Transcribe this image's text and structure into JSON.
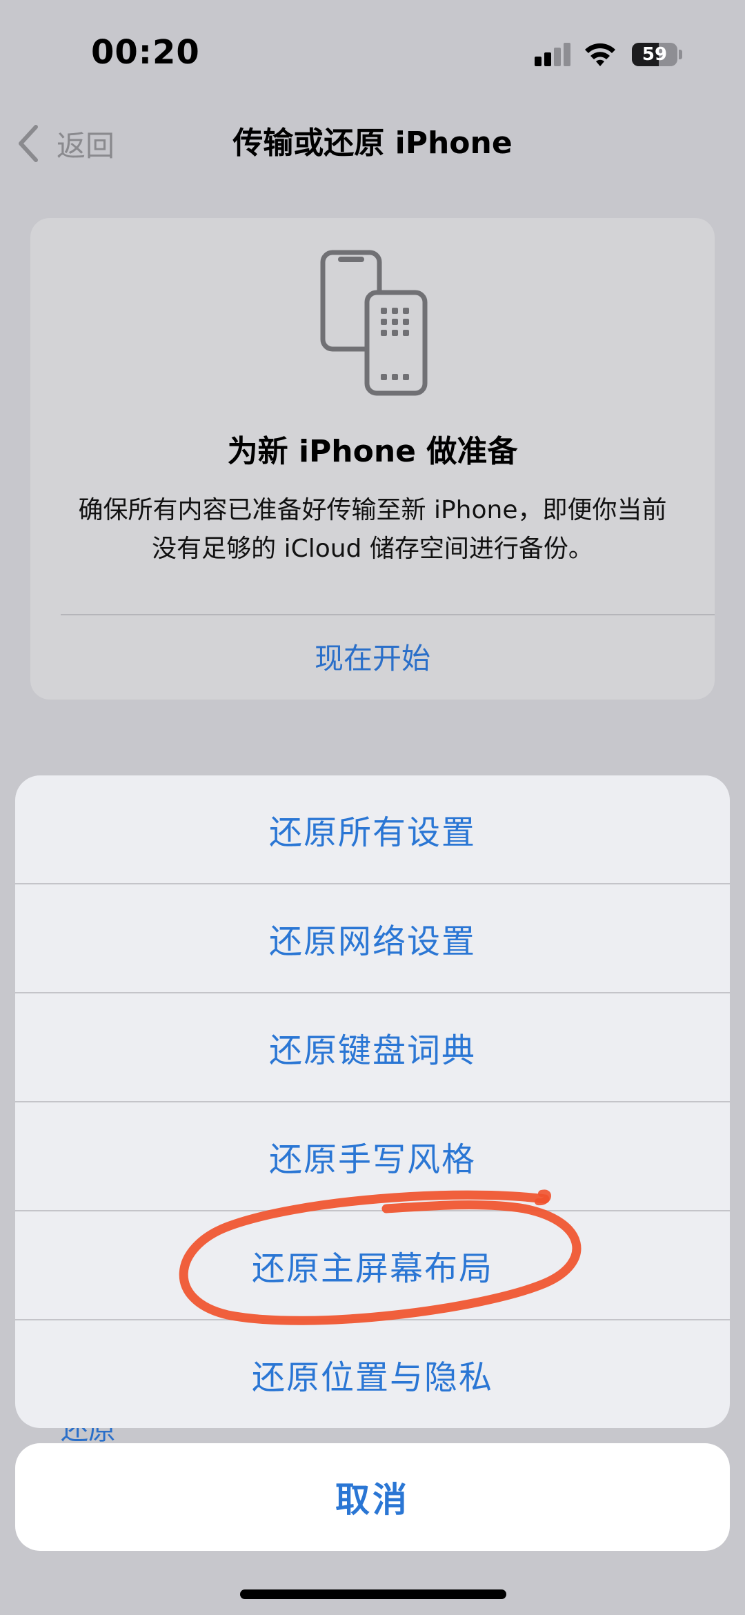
{
  "status_bar": {
    "time": "00:20",
    "battery_percent": "59",
    "battery_level": 0.59,
    "signal_bars_active": 2
  },
  "nav": {
    "back_label": "返回",
    "title": "传输或还原 iPhone"
  },
  "transfer_card": {
    "icon": "iphone-transfer-icon",
    "title": "为新 iPhone 做准备",
    "description": "确保所有内容已准备好传输至新 iPhone，即便你当前没有足够的 iCloud 储存空间进行备份。",
    "action_label": "现在开始"
  },
  "background_peek_text": "还原",
  "action_sheet": {
    "items": [
      {
        "label": "还原所有设置"
      },
      {
        "label": "还原网络设置"
      },
      {
        "label": "还原键盘词典"
      },
      {
        "label": "还原手写风格"
      },
      {
        "label": "还原主屏幕布局"
      },
      {
        "label": "还原位置与隐私"
      }
    ],
    "cancel_label": "取消"
  },
  "colors": {
    "accent": "#2a76d4",
    "annotation_stroke": "#f0522d",
    "background_dimmed": "#c7c7cc",
    "sheet_background": "#edeef2"
  }
}
